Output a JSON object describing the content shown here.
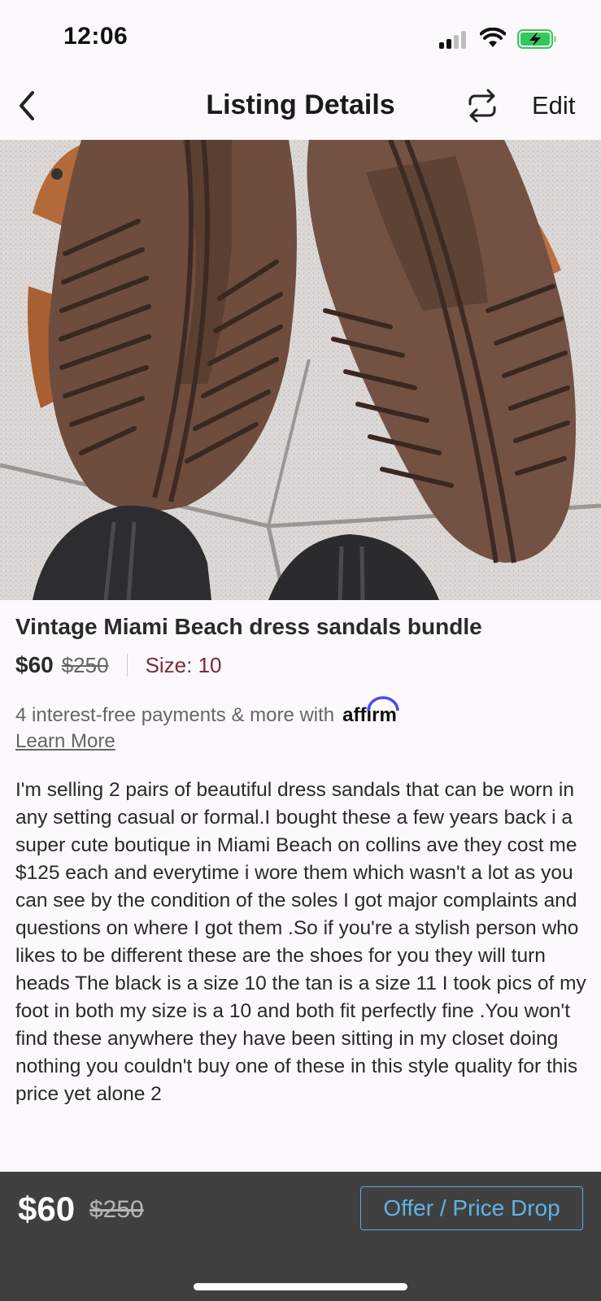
{
  "status_bar": {
    "time": "12:06",
    "icons": [
      "signal-icon",
      "wifi-icon",
      "battery-charging-icon"
    ]
  },
  "nav": {
    "title": "Listing Details",
    "back_icon": "chevron-left-icon",
    "share_icon": "repost-icon",
    "edit_label": "Edit"
  },
  "listing": {
    "title": "Vintage Miami Beach dress sandals bundle",
    "price": "$60",
    "original_price": "$250",
    "size": "Size: 10",
    "affirm_text": "4 interest-free payments & more with",
    "affirm_logo": "affirm",
    "learn_more": "Learn More",
    "description": "I'm selling 2 pairs of beautiful dress sandals that can be worn in any setting casual or formal.I bought these a few years back i a super cute boutique in Miami Beach on collins ave they cost me $125 each and everytime i wore them which wasn't a lot as you can see by the condition of the soles I got major complaints and questions on where I got them .So if you're a stylish person who likes to be different these are the shoes for you they will turn heads The black is a size 10 the tan is a size 11 I took pics of my foot in both my size is a 10 and both fit perfectly fine .You won't find these anywhere they have been sitting in my closet doing nothing you couldn't buy one of these in this style quality for this price yet alone 2"
  },
  "bottom_bar": {
    "price": "$60",
    "original_price": "$250",
    "offer_button": "Offer / Price Drop"
  },
  "colors": {
    "size_text": "#7a2a36",
    "offer_button": "#5fb3e4",
    "bottom_bar_bg": "#404040"
  }
}
